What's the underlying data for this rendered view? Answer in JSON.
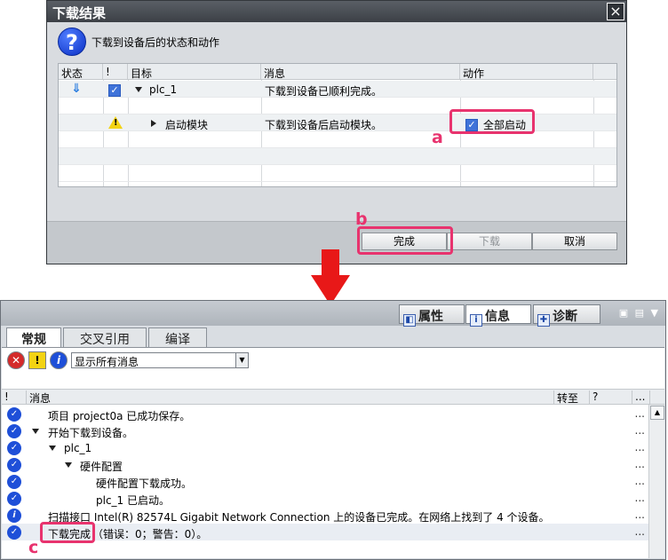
{
  "dialog": {
    "title": "下载结果",
    "close_glyph": "×",
    "header_icon": "?",
    "header_text": "下载到设备后的状态和动作",
    "columns": {
      "status": "状态",
      "flag": "!",
      "target": "目标",
      "message": "消息",
      "action": "动作"
    },
    "rows": [
      {
        "target": "plc_1",
        "message": "下载到设备已顺利完成。"
      },
      {
        "target": "启动模块",
        "message": "下载到设备后启动模块。",
        "action_label": "全部启动",
        "action_checked": true
      }
    ],
    "buttons": {
      "finish": "完成",
      "download": "下载",
      "cancel": "取消"
    },
    "callouts": {
      "a": "a",
      "b": "b",
      "c": "c"
    }
  },
  "panel": {
    "tabs": [
      {
        "label": "属性",
        "icon": "properties-icon"
      },
      {
        "label": "信息",
        "icon": "info-icon"
      },
      {
        "label": "诊断",
        "icon": "diagnostics-icon"
      }
    ],
    "subtabs": [
      "常规",
      "交叉引用",
      "编译"
    ],
    "filter": {
      "error_glyph": "✕",
      "warning_glyph": "!",
      "info_glyph": "i",
      "dropdown_value": "显示所有消息"
    },
    "columns": {
      "flag": "!",
      "message": "消息",
      "goto": "转至",
      "help": "?",
      "more": "..."
    },
    "messages": [
      {
        "text": "项目 project0a 已成功保存。",
        "more": "..."
      },
      {
        "text": "开始下载到设备。",
        "more": "..."
      },
      {
        "text": "plc_1",
        "more": "..."
      },
      {
        "text": "硬件配置",
        "more": "..."
      },
      {
        "text": "硬件配置下载成功。",
        "more": "..."
      },
      {
        "text": "plc_1 已启动。",
        "more": "..."
      },
      {
        "text": "扫描接口 Intel(R) 82574L Gigabit Network Connection 上的设备已完成。在网络上找到了 4 个设备。",
        "more": "..."
      },
      {
        "text_a": "下载完成",
        "text_b": "（错误：0；警告：0）。",
        "more": "..."
      }
    ]
  },
  "colors": {
    "highlight": "#e8336e",
    "arrow": "#e81818",
    "accent_blue": "#1e4fd8"
  }
}
